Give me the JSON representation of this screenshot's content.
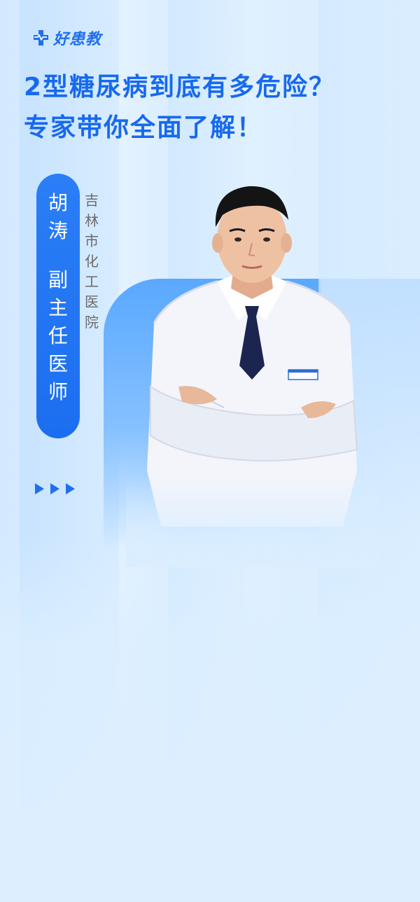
{
  "brand": {
    "logo_text": "好患教",
    "logo_icon": "medical-cross-icon",
    "accent_color": "#1f6ff0"
  },
  "headline": {
    "line1": "2型糖尿病到底有多危险？",
    "line2": "专家带你全面了解！"
  },
  "doctor": {
    "name_chars": [
      "胡",
      "涛"
    ],
    "title_chars": [
      "副",
      "主",
      "任",
      "医",
      "师"
    ],
    "hospital_chars": [
      "吉",
      "林",
      "市",
      "化",
      "工",
      "医",
      "院"
    ],
    "photo": "doctor-portrait"
  },
  "decor": {
    "arrow_icon": "play-arrow-icon",
    "arrow_count": 3
  }
}
